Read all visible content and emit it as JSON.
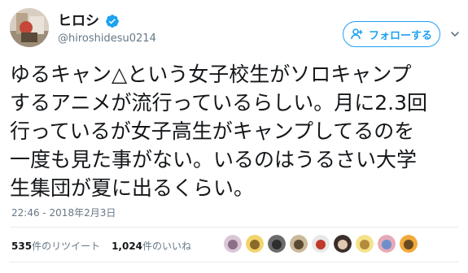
{
  "user": {
    "display_name": "ヒロシ",
    "handle": "@hiroshidesu0214",
    "verified": true
  },
  "follow_button": {
    "label": "フォローする"
  },
  "tweet": {
    "lines": [
      "ゆるキャン△という女子校生がソロキャンプ",
      "するアニメが流行っているらしい。月に2.3回",
      "行っているが女子高生がキャンプしてるのを",
      "一度も見た事がない。いるのはうるさい大学",
      "生集団が夏に出るくらい。"
    ],
    "timestamp": "22:46 - 2018年2月3日"
  },
  "stats": {
    "retweets_count": "535",
    "retweets_label": "件のリツイート",
    "likes_count": "1,024",
    "likes_label": "件のいいね"
  },
  "colors": {
    "accent": "#1da1f2",
    "secondary_text": "#657786",
    "divider": "#e6ecf0"
  },
  "icons": {
    "verified": "verified-badge-icon",
    "more": "chevron-down-icon"
  },
  "liker_avatar_colors": [
    [
      "#d9c7d6",
      "#8a6f86"
    ],
    [
      "#f2d46a",
      "#8a6a2a"
    ],
    [
      "#6b6b6b",
      "#2e2e2e"
    ],
    [
      "#c9b89a",
      "#5b4a33"
    ],
    [
      "#e8e8e8",
      "#c0392b"
    ],
    [
      "#3a2f2a",
      "#e0c9b0"
    ],
    [
      "#f3e28a",
      "#b38b3a"
    ],
    [
      "#e6a9b8",
      "#6f8fc9"
    ],
    [
      "#f0a93b",
      "#6a4a20"
    ]
  ]
}
